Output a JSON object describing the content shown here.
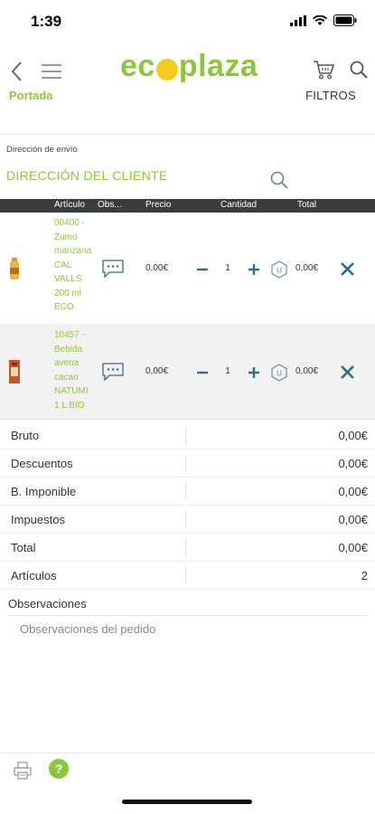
{
  "status": {
    "time": "1:39"
  },
  "header": {
    "logo": {
      "part1": "ec",
      "part2": "plaza"
    },
    "portada_label": "Portada",
    "filtros_label": "FILTROS"
  },
  "address": {
    "label": "Dirección de envío",
    "value": "DIRECCIÓN DEL CLIENTE"
  },
  "table": {
    "columns": [
      "Artículo",
      "Obs...",
      "Precio",
      "Cantidad",
      "Total"
    ]
  },
  "products": [
    {
      "name_lines": [
        "00400 -",
        "Zumo",
        "manzana",
        "CAL",
        "VALLS",
        "200 ml",
        "ECO"
      ],
      "price": "0,00€",
      "quantity": "1",
      "unit": "U",
      "total": "0,00€"
    },
    {
      "name_lines": [
        "10457 -",
        "Bebida",
        "avena",
        "cacao",
        "NATUMI",
        "1 L BIO"
      ],
      "price": "0,00€",
      "quantity": "1",
      "unit": "U",
      "total": "0,00€"
    }
  ],
  "summary": [
    {
      "label": "Bruto",
      "value": "0,00€"
    },
    {
      "label": "Descuentos",
      "value": "0,00€"
    },
    {
      "label": "B. Imponible",
      "value": "0,00€"
    },
    {
      "label": "Impuestos",
      "value": "0,00€"
    },
    {
      "label": "Total",
      "value": "0,00€"
    },
    {
      "label": "Artículos",
      "value": "2"
    }
  ],
  "observations": {
    "title": "Observaciones",
    "placeholder": "Observaciones del pedido"
  },
  "footer": {
    "help_label": "?"
  },
  "colors": {
    "brand_green": "#8cc63f",
    "logo_dot": "#f3cd1b",
    "header_bar": "#393d3f",
    "action_blue": "#2e6f86"
  },
  "icons": [
    "back-icon",
    "menu-icon",
    "cart-icon",
    "search-icon",
    "comment-icon",
    "minus-icon",
    "plus-icon",
    "unit-icon",
    "delete-icon",
    "print-icon",
    "help-icon"
  ]
}
